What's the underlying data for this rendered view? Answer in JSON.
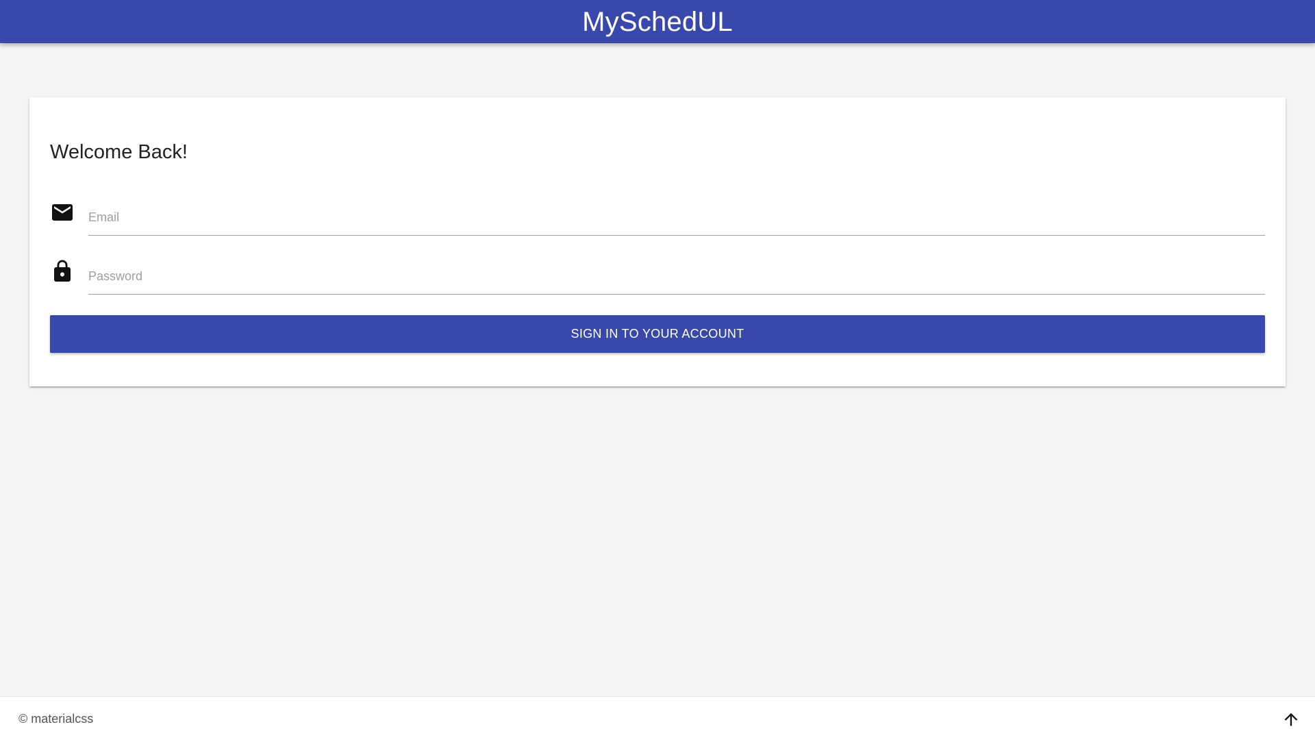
{
  "header": {
    "brand": "MySchedUL"
  },
  "login": {
    "title": "Welcome Back!",
    "email": {
      "placeholder": "Email",
      "value": "",
      "icon": "email-icon"
    },
    "password": {
      "placeholder": "Password",
      "value": "",
      "icon": "lock-icon"
    },
    "submit_label": "SIGN IN TO YOUR ACCOUNT"
  },
  "footer": {
    "copyright": "© materialcss",
    "scroll_top_icon": "arrow-up-icon"
  },
  "colors": {
    "primary": "#3949ab",
    "background": "#f4f4f4",
    "card": "#ffffff"
  }
}
